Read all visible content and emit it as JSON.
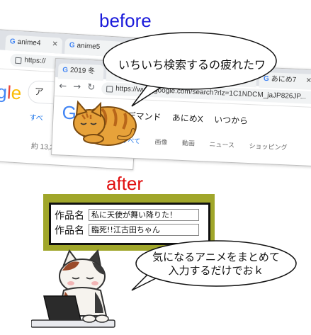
{
  "headings": {
    "before": "before",
    "after": "after"
  },
  "back_browser": {
    "tabs": [
      "anime4",
      "anime5"
    ],
    "address": "https://",
    "search_partial": "ア",
    "sub_tab": "すべ",
    "result_count": "約 13,200,000 件（0.40 秒）"
  },
  "front_browser": {
    "tabs": [
      "2019 冬",
      "",
      "",
      "",
      "",
      "あにめ7"
    ],
    "address": "https://www.google.com/search?rlz=1C1NDCM_jaJP826JP...",
    "query_terms": [
      "〇〇オンデマンド",
      "あにめX",
      "いつから"
    ],
    "sub_tabs": [
      "すべて",
      "画像",
      "動画",
      "ニュース",
      "ショッピング"
    ]
  },
  "bubbles": {
    "top": "いちいち検索するの疲れたワ",
    "bottom_line1": "気になるアニメをまとめて",
    "bottom_line2": "入力するだけでおｋ"
  },
  "app": {
    "fields": [
      {
        "label": "作品名",
        "value": "私に天使が舞い降りた！"
      },
      {
        "label": "作品名",
        "value": "臨死!!江古田ちゃん"
      }
    ]
  },
  "colors": {
    "before_heading": "#1a1adb",
    "after_heading": "#e01010",
    "app_panel_bg": "#a0a62a",
    "cat_orange": "#e7a23a"
  },
  "icons": [
    "google-g-icon",
    "close-icon",
    "back-arrow-icon",
    "forward-arrow-icon",
    "reload-icon",
    "lock-icon",
    "cat-illustration",
    "laptop-illustration"
  ]
}
